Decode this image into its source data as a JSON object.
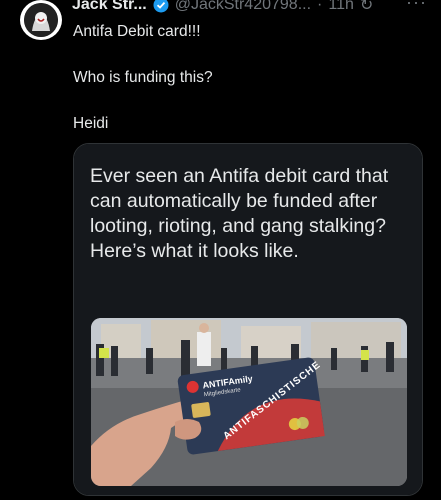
{
  "tweet": {
    "author_name": "Jack Str...",
    "handle": "@JackStr420798...",
    "time": "11h",
    "text_line1": "Antifa Debit card!!!",
    "text_line2": "Who is funding this?",
    "text_line3": "Heidi"
  },
  "quote": {
    "text": "Ever seen an Antifa debit card that can automatically be funded after looting, rioting, and gang stalking? Here’s what it looks like.",
    "card_brand": "ANTIFAmily",
    "card_sub": "Mitgliedskarte",
    "card_arc": "ANTIFASCHISTISCHE"
  },
  "icons": [
    "avatar",
    "verified-icon",
    "more-icon"
  ],
  "colors": {
    "background": "#000000",
    "text": "#e7e9ea",
    "muted": "#71767b",
    "verified": "#1d9bf0",
    "quote_bg": "#15181c",
    "border": "#2f3336"
  }
}
